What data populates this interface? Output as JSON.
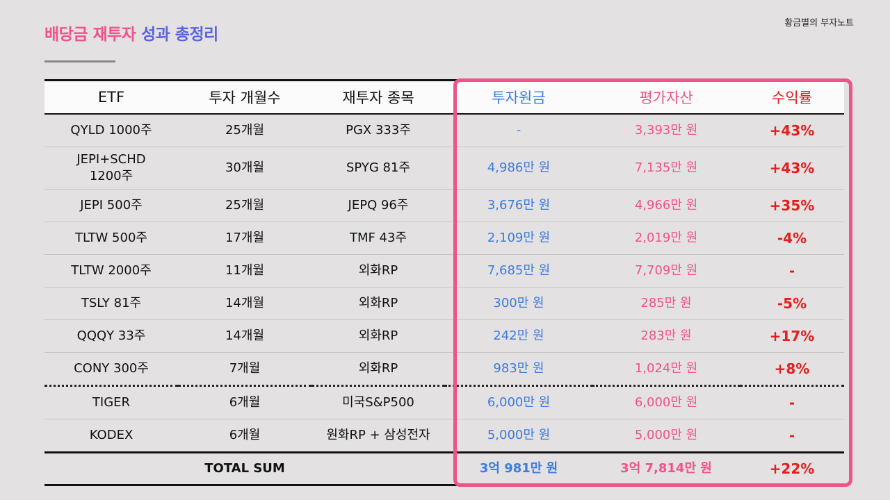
{
  "header": {
    "title_part1": "배당금 재투자",
    "title_part2": "성과 총정리",
    "brand": "황금별의 부자노트"
  },
  "table": {
    "columns": [
      "ETF",
      "투자 개월수",
      "재투자 종목",
      "투자원금",
      "평가자산",
      "수익률"
    ],
    "rows": [
      {
        "etf": "QYLD 1000주",
        "months": "25개월",
        "reinvest": "PGX 333주",
        "principal": "-",
        "value": "3,393만 원",
        "return": "+43%"
      },
      {
        "etf": "JEPI+SCHD\n1200주",
        "months": "30개월",
        "reinvest": "SPYG 81주",
        "principal": "4,986만 원",
        "value": "7,135만 원",
        "return": "+43%"
      },
      {
        "etf": "JEPI 500주",
        "months": "25개월",
        "reinvest": "JEPQ 96주",
        "principal": "3,676만 원",
        "value": "4,966만 원",
        "return": "+35%"
      },
      {
        "etf": "TLTW 500주",
        "months": "17개월",
        "reinvest": "TMF 43주",
        "principal": "2,109만 원",
        "value": "2,019만 원",
        "return": "-4%"
      },
      {
        "etf": "TLTW 2000주",
        "months": "11개월",
        "reinvest": "외화RP",
        "principal": "7,685만 원",
        "value": "7,709만 원",
        "return": "-"
      },
      {
        "etf": "TSLY 81주",
        "months": "14개월",
        "reinvest": "외화RP",
        "principal": "300만 원",
        "value": "285만 원",
        "return": "-5%"
      },
      {
        "etf": "QQQY 33주",
        "months": "14개월",
        "reinvest": "외화RP",
        "principal": "242만 원",
        "value": "283만 원",
        "return": "+17%"
      },
      {
        "etf": "CONY 300주",
        "months": "7개월",
        "reinvest": "외화RP",
        "principal": "983만 원",
        "value": "1,024만 원",
        "return": "+8%"
      },
      {
        "etf": "TIGER",
        "months": "6개월",
        "reinvest": "미국S&P500",
        "principal": "6,000만 원",
        "value": "6,000만 원",
        "return": "-"
      },
      {
        "etf": "KODEX",
        "months": "6개월",
        "reinvest": "원화RP + 삼성전자",
        "principal": "5,000만 원",
        "value": "5,000만 원",
        "return": "-"
      }
    ],
    "total": {
      "label": "TOTAL SUM",
      "principal": "3억 981만 원",
      "value": "3억 7,814만 원",
      "return": "+22%"
    }
  },
  "colors": {
    "accent_pink": "#f0528a",
    "accent_blue": "#3b7bdc",
    "title_blue": "#5b63e0",
    "return_red": "#e0201e",
    "background": "#e3e1e2"
  }
}
